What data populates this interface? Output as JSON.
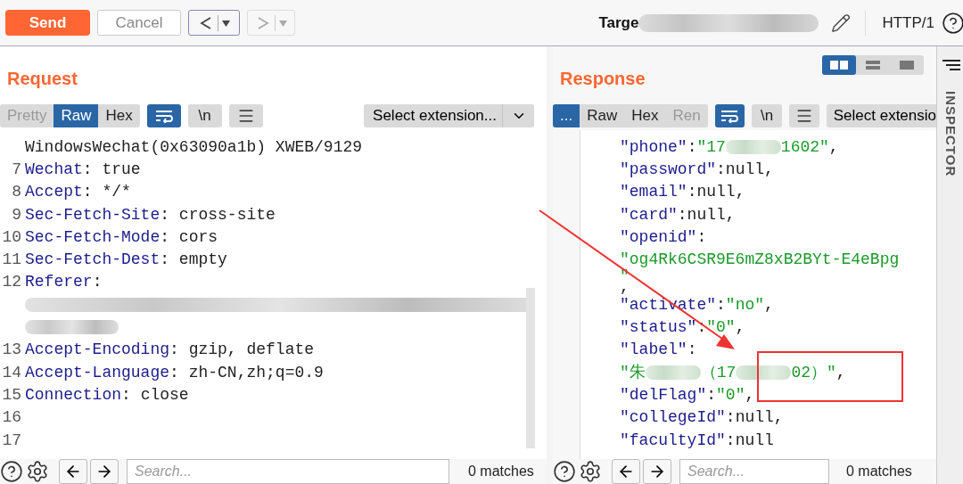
{
  "toolbar": {
    "send": "Send",
    "cancel": "Cancel",
    "back": {
      "disabled": false
    },
    "forward": {
      "disabled": true
    },
    "target_label": "Targe",
    "protocol": "HTTP/1"
  },
  "layout_toggles": [
    {
      "kind": "columns",
      "selected": true
    },
    {
      "kind": "rows",
      "selected": false
    },
    {
      "kind": "single",
      "selected": false
    }
  ],
  "inspector": {
    "label": "INSPECTOR"
  },
  "request": {
    "title": "Request",
    "view_tabs": [
      {
        "label": "Pretty",
        "selected": false,
        "disabled": true
      },
      {
        "label": "Raw",
        "selected": true,
        "disabled": false
      },
      {
        "label": "Hex",
        "selected": false,
        "disabled": false
      }
    ],
    "wrap_lines": true,
    "newline_label": "\\n",
    "select_extension": "Select extension...",
    "search": {
      "placeholder": "Search..."
    },
    "matches": "0 matches",
    "lines": [
      {
        "segments": [
          {
            "kind": "plain",
            "text": "WindowsWechat(0x63090a1b) XWEB/9129"
          }
        ]
      },
      {
        "number": "7",
        "segments": [
          {
            "kind": "key",
            "text": "Wechat"
          },
          {
            "kind": "plain",
            "text": ": true"
          }
        ]
      },
      {
        "number": "8",
        "segments": [
          {
            "kind": "key",
            "text": "Accept"
          },
          {
            "kind": "plain",
            "text": ": */*"
          }
        ]
      },
      {
        "number": "9",
        "segments": [
          {
            "kind": "key",
            "text": "Sec-Fetch-Site"
          },
          {
            "kind": "plain",
            "text": ": cross-site"
          }
        ]
      },
      {
        "number": "10",
        "segments": [
          {
            "kind": "key",
            "text": "Sec-Fetch-Mode"
          },
          {
            "kind": "plain",
            "text": ": cors"
          }
        ]
      },
      {
        "number": "11",
        "segments": [
          {
            "kind": "key",
            "text": "Sec-Fetch-Dest"
          },
          {
            "kind": "plain",
            "text": ": empty"
          }
        ]
      },
      {
        "number": "12",
        "segments": [
          {
            "kind": "key",
            "text": "Referer"
          },
          {
            "kind": "plain",
            "text": ":"
          }
        ]
      },
      {
        "segments": [
          {
            "kind": "blur"
          }
        ]
      },
      {
        "segments": [
          {
            "kind": "blur"
          }
        ]
      },
      {
        "number": "13",
        "segments": [
          {
            "kind": "key",
            "text": "Accept-Encoding"
          },
          {
            "kind": "plain",
            "text": ": gzip, deflate"
          }
        ]
      },
      {
        "number": "14",
        "segments": [
          {
            "kind": "key",
            "text": "Accept-Language"
          },
          {
            "kind": "plain",
            "text": ": zh-CN,zh;q=0.9"
          }
        ]
      },
      {
        "number": "15",
        "segments": [
          {
            "kind": "key",
            "text": "Connection"
          },
          {
            "kind": "plain",
            "text": ": close"
          }
        ]
      },
      {
        "number": "16"
      },
      {
        "number": "17"
      }
    ]
  },
  "response": {
    "title": "Response",
    "view_tabs": [
      {
        "label": "...",
        "selected": true,
        "disabled": false
      },
      {
        "label": "Raw",
        "selected": false,
        "disabled": false
      },
      {
        "label": "Hex",
        "selected": false,
        "disabled": false
      },
      {
        "label": "Ren",
        "selected": false,
        "disabled": true
      }
    ],
    "wrap_lines": true,
    "newline_label": "\\n",
    "select_extension": "Select extensio",
    "search": {
      "placeholder": "Search..."
    },
    "matches": "0 matches",
    "lines": [
      {
        "segments": [
          {
            "kind": "key",
            "text": "\"phone\""
          },
          {
            "kind": "plain",
            "text": ":"
          },
          {
            "kind": "string",
            "text": "\"17"
          },
          {
            "kind": "blur"
          },
          {
            "kind": "string",
            "text": "1602\""
          },
          {
            "kind": "plain",
            "text": ","
          }
        ]
      },
      {
        "segments": [
          {
            "kind": "key",
            "text": "\"password\""
          },
          {
            "kind": "plain",
            "text": ":null,"
          }
        ]
      },
      {
        "segments": [
          {
            "kind": "key",
            "text": "\"email\""
          },
          {
            "kind": "plain",
            "text": ":null,"
          }
        ]
      },
      {
        "segments": [
          {
            "kind": "key",
            "text": "\"card\""
          },
          {
            "kind": "plain",
            "text": ":null,"
          }
        ]
      },
      {
        "segments": [
          {
            "kind": "key",
            "text": "\"openid\""
          },
          {
            "kind": "plain",
            "text": ":"
          }
        ]
      },
      {
        "segments": [
          {
            "kind": "string",
            "text": "\"og4Rk6CSR9E6mZ8xB2BYt-E4eBpg"
          }
        ]
      },
      {
        "stacked": true,
        "segments": [
          {
            "kind": "string",
            "text": "\""
          },
          {
            "kind": "plain",
            "text": ","
          }
        ]
      },
      {
        "segments": [
          {
            "kind": "key",
            "text": "\"activate\""
          },
          {
            "kind": "plain",
            "text": ":"
          },
          {
            "kind": "string",
            "text": "\"no\""
          },
          {
            "kind": "plain",
            "text": ","
          }
        ]
      },
      {
        "segments": [
          {
            "kind": "key",
            "text": "\"status\""
          },
          {
            "kind": "plain",
            "text": ":"
          },
          {
            "kind": "string",
            "text": "\"0\""
          },
          {
            "kind": "plain",
            "text": ","
          }
        ]
      },
      {
        "segments": [
          {
            "kind": "key",
            "text": "\"label\""
          },
          {
            "kind": "plain",
            "text": ":"
          }
        ]
      },
      {
        "segments": [
          {
            "kind": "string",
            "text": "\"朱"
          },
          {
            "kind": "blur"
          },
          {
            "kind": "string",
            "text": "（17"
          },
          {
            "kind": "blur"
          },
          {
            "kind": "string",
            "text": "02）\""
          },
          {
            "kind": "plain",
            "text": ","
          }
        ]
      },
      {
        "segments": [
          {
            "kind": "key",
            "text": "\"delFlag\""
          },
          {
            "kind": "plain",
            "text": ":"
          },
          {
            "kind": "string",
            "text": "\"0\""
          },
          {
            "kind": "plain",
            "text": ","
          }
        ]
      },
      {
        "segments": [
          {
            "kind": "key",
            "text": "\"collegeId\""
          },
          {
            "kind": "plain",
            "text": ":null,"
          }
        ]
      },
      {
        "segments": [
          {
            "kind": "key",
            "text": "\"facultyId\""
          },
          {
            "kind": "plain",
            "text": ":null"
          }
        ]
      }
    ]
  }
}
